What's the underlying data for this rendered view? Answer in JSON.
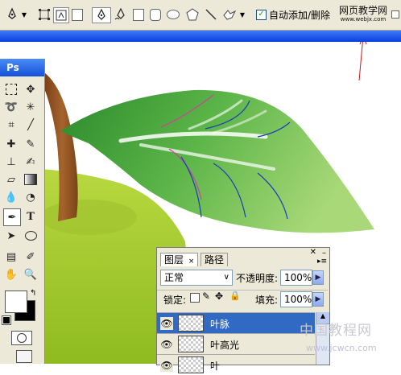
{
  "options_bar": {
    "auto_add_delete_label": "自动添加/删除",
    "auto_add_delete_checked": true
  },
  "watermark_top": {
    "line1": "网页教学网",
    "line2": "www.webjx.com"
  },
  "toolbox": {
    "title": "Ps",
    "text_tool_glyph": "T"
  },
  "layers_panel": {
    "tabs": [
      "图层",
      "路径"
    ],
    "blend_mode": "正常",
    "opacity_label": "不透明度:",
    "opacity_value": "100%",
    "lock_label": "锁定:",
    "fill_label": "填充:",
    "fill_value": "100%",
    "layers": [
      {
        "name": "叶脉",
        "selected": true
      },
      {
        "name": "叶高光",
        "selected": false
      },
      {
        "name": "叶",
        "selected": false
      }
    ]
  },
  "watermark_bottom": {
    "text": "中国教程网",
    "url": "www.jcwcn.com"
  },
  "colors": {
    "leaf_dark": "#2e8b2e",
    "leaf_light": "#9ed36b",
    "apple_green": "#a8cc3a",
    "stem_brown": "#8b4a1c",
    "selected_row": "#316ac5",
    "path_blue": "#1a3dbb",
    "path_pink": "#d040a0"
  }
}
